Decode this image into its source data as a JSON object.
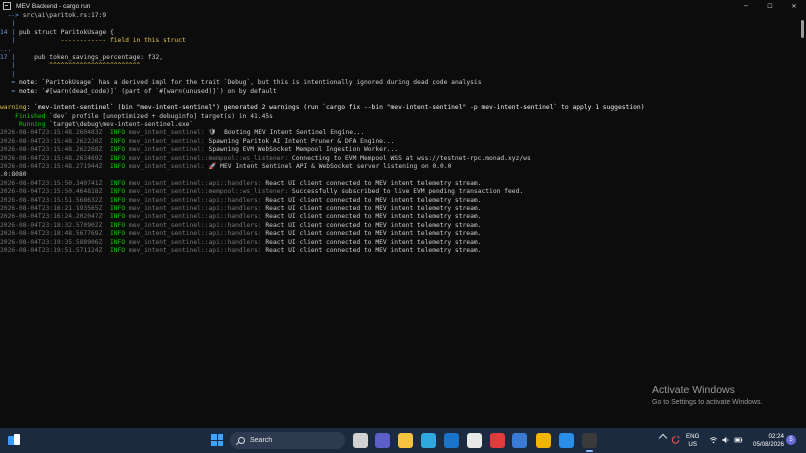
{
  "window": {
    "title": "MEV Backend - cargo  run",
    "controls": {
      "minimize": "─",
      "maximize": "☐",
      "close": "✕"
    }
  },
  "terminal": {
    "lines": [
      {
        "segments": [
          {
            "text": "  --> ",
            "color": "blue"
          },
          {
            "text": "src\\ai\\paritok.rs:17:9",
            "color": "gray"
          }
        ]
      },
      {
        "segments": [
          {
            "text": "   |",
            "color": "blue"
          }
        ]
      },
      {
        "segments": [
          {
            "text": "14 |",
            "color": "blue"
          },
          {
            "text": " pub struct ParitokUsage {",
            "color": "gray"
          }
        ]
      },
      {
        "segments": [
          {
            "text": "   |",
            "color": "blue"
          },
          {
            "text": "            ------------ field in this struct",
            "color": "yellow"
          }
        ]
      },
      {
        "segments": [
          {
            "text": "...",
            "color": "blue"
          }
        ]
      },
      {
        "segments": [
          {
            "text": "17 |",
            "color": "blue"
          },
          {
            "text": "     pub token_savings_percentage: f32,",
            "color": "gray"
          }
        ]
      },
      {
        "segments": [
          {
            "text": "   |",
            "color": "blue"
          },
          {
            "text": "         ^^^^^^^^^^^^^^^^^^^^^^^^",
            "color": "yellow"
          }
        ]
      },
      {
        "segments": [
          {
            "text": "   |",
            "color": "blue"
          }
        ]
      },
      {
        "segments": [
          {
            "text": "   = ",
            "color": "blue"
          },
          {
            "text": "note",
            "color": "white"
          },
          {
            "text": ": `ParitokUsage` has a derived impl for the trait `Debug`, but this is intentionally ignored during dead code analysis",
            "color": "gray"
          }
        ]
      },
      {
        "segments": [
          {
            "text": "   = ",
            "color": "blue"
          },
          {
            "text": "note",
            "color": "white"
          },
          {
            "text": ": `#[warn(dead_code)]` (part of `#[warn(unused)]`) on by default",
            "color": "gray"
          }
        ]
      },
      {
        "segments": [
          {
            "text": "",
            "color": "gray"
          }
        ]
      },
      {
        "segments": [
          {
            "text": "warning",
            "color": "yellow"
          },
          {
            "text": ": `mev-intent-sentinel` (bin \"mev-intent-sentinel\") generated 2 warnings (run `cargo fix --bin \"mev-intent-sentinel\" -p mev-intent-sentinel` to apply 1 suggestion)",
            "color": "white"
          }
        ]
      },
      {
        "segments": [
          {
            "text": "    Finished",
            "color": "green"
          },
          {
            "text": " `dev` profile [unoptimized + debuginfo] target(s) in 41.45s",
            "color": "gray"
          }
        ]
      },
      {
        "segments": [
          {
            "text": "     Running",
            "color": "green"
          },
          {
            "text": " `target\\debug\\mev-intent-sentinel.exe`",
            "color": "gray"
          }
        ]
      },
      {
        "segments": [
          {
            "text": "2026-08-04T23:15:48.260483Z",
            "color": "dim"
          },
          {
            "text": "  INFO",
            "color": "green"
          },
          {
            "text": " mev_intent_sentinel:",
            "color": "dim"
          },
          {
            "text": " 🛡  Booting MEV Intent Sentinel Engine...",
            "color": "gray"
          }
        ]
      },
      {
        "segments": [
          {
            "text": "2026-08-04T23:15:48.262226Z",
            "color": "dim"
          },
          {
            "text": "  INFO",
            "color": "green"
          },
          {
            "text": " mev_intent_sentinel:",
            "color": "dim"
          },
          {
            "text": " Spawning Paritok AI Intent Pruner & DFA Engine...",
            "color": "gray"
          }
        ]
      },
      {
        "segments": [
          {
            "text": "2026-08-04T23:15:48.262268Z",
            "color": "dim"
          },
          {
            "text": "  INFO",
            "color": "green"
          },
          {
            "text": " mev_intent_sentinel:",
            "color": "dim"
          },
          {
            "text": " Spawning EVM WebSocket Mempool Ingestion Worker...",
            "color": "gray"
          }
        ]
      },
      {
        "segments": [
          {
            "text": "2026-08-04T23:15:48.263469Z",
            "color": "dim"
          },
          {
            "text": "  INFO",
            "color": "green"
          },
          {
            "text": " mev_intent_sentinel::mempool::ws_listener:",
            "color": "dim"
          },
          {
            "text": " Connecting to EVM Mempool WSS at wss://testnet-rpc.monad.xyz/ws",
            "color": "gray"
          }
        ]
      },
      {
        "segments": [
          {
            "text": "2026-08-04T23:15:48.271944Z",
            "color": "dim"
          },
          {
            "text": "  INFO",
            "color": "green"
          },
          {
            "text": " mev_intent_sentinel:",
            "color": "dim"
          },
          {
            "text": " 🚀 MEV Intent Sentinel API & WebSocket server listening on 0.0.0",
            "color": "gray"
          }
        ]
      },
      {
        "segments": [
          {
            "text": ".0:8080",
            "color": "gray"
          }
        ]
      },
      {
        "segments": [
          {
            "text": "2026-08-04T23:15:50.340741Z",
            "color": "dim"
          },
          {
            "text": "  INFO",
            "color": "green"
          },
          {
            "text": " mev_intent_sentinel::api::handlers:",
            "color": "dim"
          },
          {
            "text": " React UI client connected to MEV intent telemetry stream.",
            "color": "gray"
          }
        ]
      },
      {
        "segments": [
          {
            "text": "2026-08-04T23:15:50.464818Z",
            "color": "dim"
          },
          {
            "text": "  INFO",
            "color": "green"
          },
          {
            "text": " mev_intent_sentinel::mempool::ws_listener:",
            "color": "dim"
          },
          {
            "text": " Successfully subscribed to live EVM pending transaction feed.",
            "color": "gray"
          }
        ]
      },
      {
        "segments": [
          {
            "text": "2026-08-04T23:15:51.568632Z",
            "color": "dim"
          },
          {
            "text": "  INFO",
            "color": "green"
          },
          {
            "text": " mev_intent_sentinel::api::handlers:",
            "color": "dim"
          },
          {
            "text": " React UI client connected to MEV intent telemetry stream.",
            "color": "gray"
          }
        ]
      },
      {
        "segments": [
          {
            "text": "2026-08-04T23:16:21.193565Z",
            "color": "dim"
          },
          {
            "text": "  INFO",
            "color": "green"
          },
          {
            "text": " mev_intent_sentinel::api::handlers:",
            "color": "dim"
          },
          {
            "text": " React UI client connected to MEV intent telemetry stream.",
            "color": "gray"
          }
        ]
      },
      {
        "segments": [
          {
            "text": "2026-08-04T23:16:24.202047Z",
            "color": "dim"
          },
          {
            "text": "  INFO",
            "color": "green"
          },
          {
            "text": " mev_intent_sentinel::api::handlers:",
            "color": "dim"
          },
          {
            "text": " React UI client connected to MEV intent telemetry stream.",
            "color": "gray"
          }
        ]
      },
      {
        "segments": [
          {
            "text": "2026-08-04T23:18:32.570902Z",
            "color": "dim"
          },
          {
            "text": "  INFO",
            "color": "green"
          },
          {
            "text": " mev_intent_sentinel::api::handlers:",
            "color": "dim"
          },
          {
            "text": " React UI client connected to MEV intent telemetry stream.",
            "color": "gray"
          }
        ]
      },
      {
        "segments": [
          {
            "text": "2026-08-04T23:18:48.567769Z",
            "color": "dim"
          },
          {
            "text": "  INFO",
            "color": "green"
          },
          {
            "text": " mev_intent_sentinel::api::handlers:",
            "color": "dim"
          },
          {
            "text": " React UI client connected to MEV intent telemetry stream.",
            "color": "gray"
          }
        ]
      },
      {
        "segments": [
          {
            "text": "2026-08-04T23:19:35.588906Z",
            "color": "dim"
          },
          {
            "text": "  INFO",
            "color": "green"
          },
          {
            "text": " mev_intent_sentinel::api::handlers:",
            "color": "dim"
          },
          {
            "text": " React UI client connected to MEV intent telemetry stream.",
            "color": "gray"
          }
        ]
      },
      {
        "segments": [
          {
            "text": "2026-08-04T23:19:51.571124Z",
            "color": "dim"
          },
          {
            "text": "  INFO",
            "color": "green"
          },
          {
            "text": " mev_intent_sentinel::api::handlers:",
            "color": "dim"
          },
          {
            "text": " React UI client connected to MEV intent telemetry stream.",
            "color": "gray"
          }
        ]
      }
    ]
  },
  "colors": {
    "blue": "#6c9bd8",
    "gray": "#cccccc",
    "yellow": "#e5c54c",
    "green": "#16c60c",
    "dim": "#767676",
    "white": "#f2f2f2",
    "terminal_bg": "#0c0c0c",
    "taskbar_bg": "#1c2a40"
  },
  "watermark": {
    "title": "Activate Windows",
    "subtitle": "Go to Settings to activate Windows."
  },
  "taskbar": {
    "search_label": "Search",
    "apps": [
      {
        "name": "task-view-icon",
        "color": "#d0d0d0"
      },
      {
        "name": "chat-icon",
        "color": "#5b5fc7"
      },
      {
        "name": "file-explorer-icon",
        "color": "#f5c242"
      },
      {
        "name": "edge-icon",
        "color": "#2fa8e0"
      },
      {
        "name": "outlook-icon",
        "color": "#1a73c9"
      },
      {
        "name": "store-icon",
        "color": "#e8e8e8"
      },
      {
        "name": "red-app-icon",
        "color": "#e23b3b"
      },
      {
        "name": "remote-desktop-icon",
        "color": "#3a7bd5"
      },
      {
        "name": "chrome-icon",
        "color": "#f2b400"
      },
      {
        "name": "vscode-icon",
        "color": "#2b8ee6"
      },
      {
        "name": "terminal-icon",
        "color": "#3a3a3a"
      }
    ],
    "tray": {
      "lang_top": "ENG",
      "lang_bottom": "US",
      "time": "02:24",
      "date": "05/08/2026",
      "notification_count": "5"
    }
  }
}
